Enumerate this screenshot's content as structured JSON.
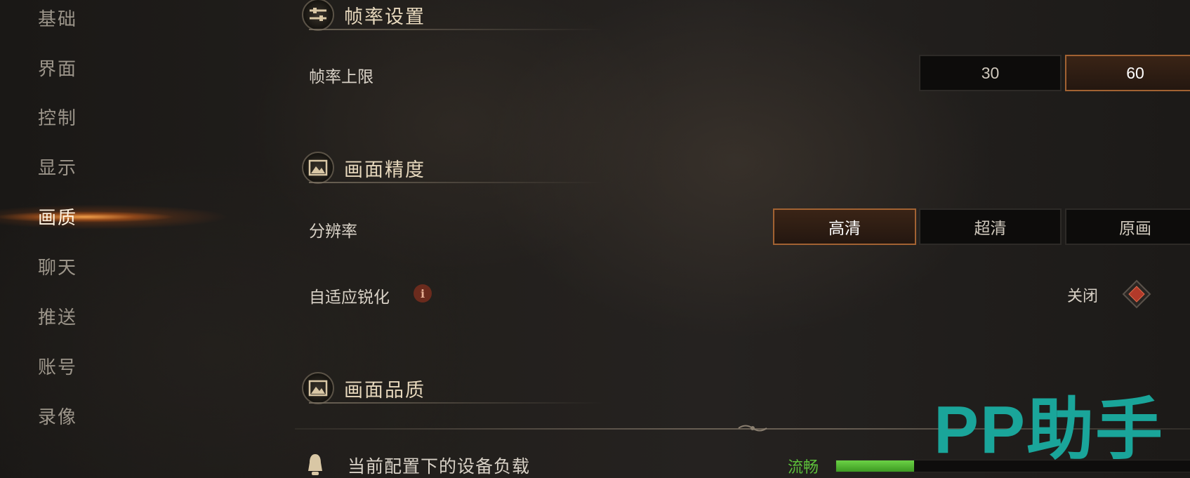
{
  "sidebar": {
    "items": [
      {
        "label": "基础"
      },
      {
        "label": "界面"
      },
      {
        "label": "控制"
      },
      {
        "label": "显示"
      },
      {
        "label": "画质",
        "active": true
      },
      {
        "label": "聊天"
      },
      {
        "label": "推送"
      },
      {
        "label": "账号"
      },
      {
        "label": "录像"
      }
    ]
  },
  "sections": {
    "framerate": {
      "title": "帧率设置",
      "icon": "sliders-icon",
      "cap_label": "帧率上限",
      "options": [
        "30",
        "60"
      ],
      "selected": "60"
    },
    "precision": {
      "title": "画面精度",
      "icon": "picture-icon",
      "resolution_label": "分辨率",
      "options": [
        "高清",
        "超清",
        "原画"
      ],
      "selected": "高清",
      "sharpen_label": "自适应锐化",
      "sharpen_info_icon": "info-icon",
      "sharpen_state": "关闭"
    },
    "quality": {
      "title": "画面品质",
      "icon": "picture-icon",
      "load_label": "当前配置下的设备负载",
      "load_status": "流畅",
      "load_status_color": "#5cbf3a",
      "load_level": 0.22
    }
  },
  "watermark": "PP助手",
  "colors": {
    "accent": "#a26232",
    "watermark": "#1aa59a"
  }
}
